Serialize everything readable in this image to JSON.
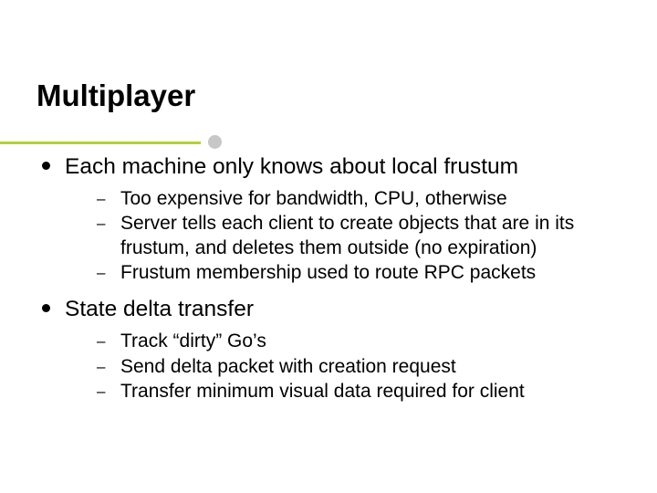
{
  "title": "Multiplayer",
  "items": [
    {
      "label": "Each machine only knows about local frustum",
      "sub": [
        "Too expensive for bandwidth, CPU, otherwise",
        "Server tells each client to create objects that are in its frustum, and deletes them outside (no expiration)",
        "Frustum membership used to route RPC packets"
      ]
    },
    {
      "label": "State delta transfer",
      "sub": [
        "Track “dirty” Go’s",
        "Send delta packet with creation request",
        "Transfer minimum visual data required for client"
      ]
    }
  ]
}
